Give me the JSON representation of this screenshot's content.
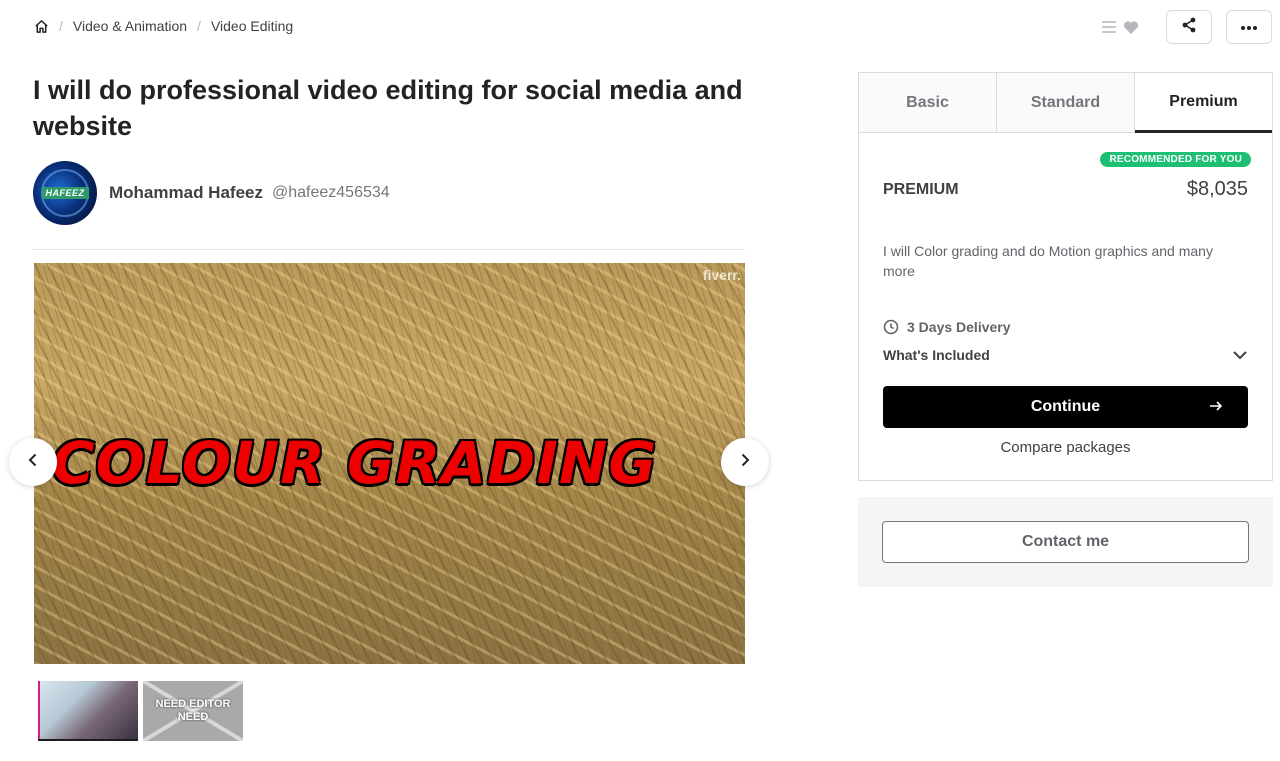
{
  "breadcrumb": {
    "home_icon": "home-icon",
    "items": [
      "Video & Animation",
      "Video Editing"
    ]
  },
  "top_actions": {
    "icons": [
      "list-icon",
      "heart-icon",
      "share-icon",
      "more-icon"
    ]
  },
  "gig": {
    "title": "I will do professional video editing for social media and website"
  },
  "seller": {
    "avatar_text": "HAFEEZ",
    "name": "Mohammad Hafeez",
    "handle": "@hafeez456534"
  },
  "gallery": {
    "watermark": "fiverr.",
    "overlay_text": "COLOUR GRADING",
    "thumbs": [
      {
        "label": ""
      },
      {
        "label": "NEED EDITOR NEED"
      }
    ]
  },
  "package": {
    "tabs": [
      "Basic",
      "Standard",
      "Premium"
    ],
    "active_tab": "Premium",
    "badge": "RECOMMENDED FOR YOU",
    "name": "PREMIUM",
    "price": "$8,035",
    "description": "I will Color grading and do Motion graphics and many more",
    "delivery": "3 Days Delivery",
    "included_label": "What's Included",
    "continue_label": "Continue",
    "compare_label": "Compare packages"
  },
  "contact": {
    "label": "Contact me"
  },
  "colors": {
    "accent_green": "#1dbf73",
    "primary_black": "#000000",
    "overlay_red": "#ee0000"
  }
}
